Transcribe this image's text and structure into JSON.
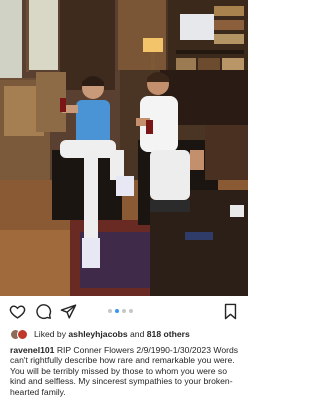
{
  "post": {
    "photo": {
      "description_icon": "photo-of-two-men-seated-in-wood-paneled-room"
    },
    "carousel": {
      "slide_count": 4,
      "active_index": 1,
      "active_color": "#3897f0",
      "inactive_color": "#c7c7c7"
    },
    "actions": {
      "like_icon": "heart-icon",
      "comment_icon": "comment-icon",
      "share_icon": "send-icon",
      "save_icon": "bookmark-icon"
    },
    "likes": {
      "prefix": "Liked by ",
      "user": "ashleyhjacobs",
      "middle": " and ",
      "others": "818 others"
    },
    "caption": {
      "username": "ravenel101",
      "text": " RIP Conner Flowers 2/9/1990-1/30/2023 Words can't rightfully describe how rare and remarkable you were. You will be terribly missed by those to whom you were so kind and selfless. My sincerest sympathies to your broken-hearted family."
    }
  }
}
